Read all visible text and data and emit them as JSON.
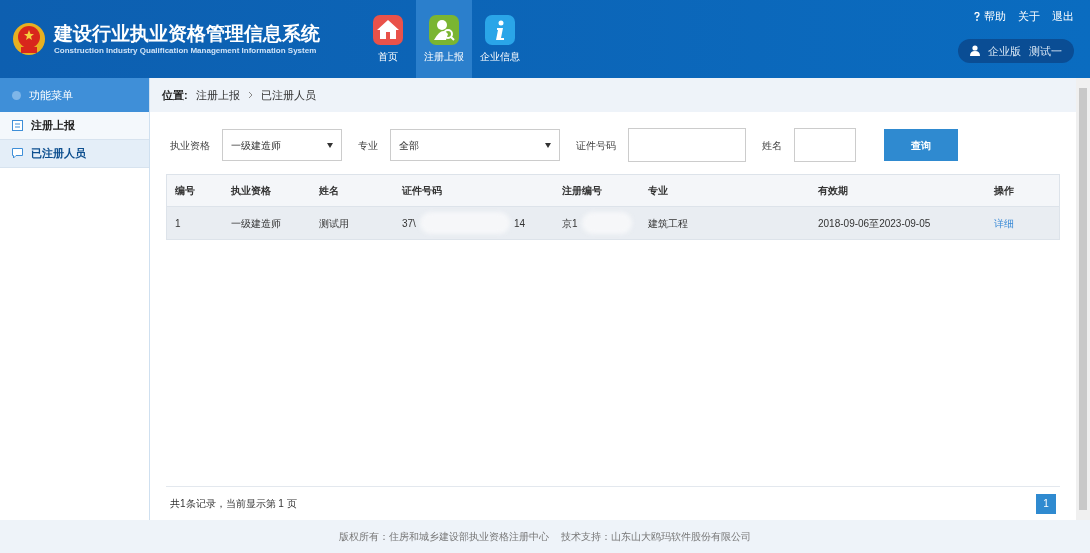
{
  "header": {
    "title": "建设行业执业资格管理信息系统",
    "subtitle": "Construction Industry Qualification Management Information System",
    "nav": [
      {
        "label": "首页",
        "kind": "home",
        "selected": false
      },
      {
        "label": "注册上报",
        "kind": "register",
        "selected": true
      },
      {
        "label": "企业信息",
        "kind": "info",
        "selected": false
      }
    ],
    "links": [
      {
        "label": "帮助",
        "kind": "help"
      },
      {
        "label": "关于",
        "kind": "plain"
      },
      {
        "label": "退出",
        "kind": "plain"
      }
    ],
    "user": {
      "edition": "企业版",
      "name": "测试一"
    }
  },
  "sidebar": {
    "title": "功能菜单",
    "items": [
      {
        "label": "注册上报",
        "selected": false
      },
      {
        "label": "已注册人员",
        "selected": true
      }
    ]
  },
  "breadcrumb": {
    "label": "位置:",
    "items": [
      "注册上报",
      "已注册人员"
    ]
  },
  "filters": [
    {
      "label": "执业资格",
      "kind": "select",
      "value": "一级建造师"
    },
    {
      "label": "专业",
      "kind": "select",
      "value": "全部"
    },
    {
      "label": "证件号码",
      "kind": "input"
    },
    {
      "label": "姓名",
      "kind": "input"
    }
  ],
  "search_button": "查询",
  "table": {
    "columns": [
      "编号",
      "执业资格",
      "姓名",
      "证件号码",
      "注册编号",
      "专业",
      "有效期",
      "操作"
    ],
    "rows": [
      {
        "no": "1",
        "qualification": "一级建造师",
        "name": "测试用",
        "id_start": "37\\",
        "id_end": "14",
        "reg_start": "京1",
        "specialty": "建筑工程",
        "validity": "2018-09-06至2023-09-05",
        "action": "详细"
      }
    ]
  },
  "pager": {
    "summary": "共1条记录，当前显示第 1 页",
    "pages": [
      {
        "label": "1",
        "selected": true
      }
    ]
  },
  "footer": "版权所有：住房和城乡建设部执业资格注册中心    技术支持：山东山大鸥玛软件股份有限公司"
}
